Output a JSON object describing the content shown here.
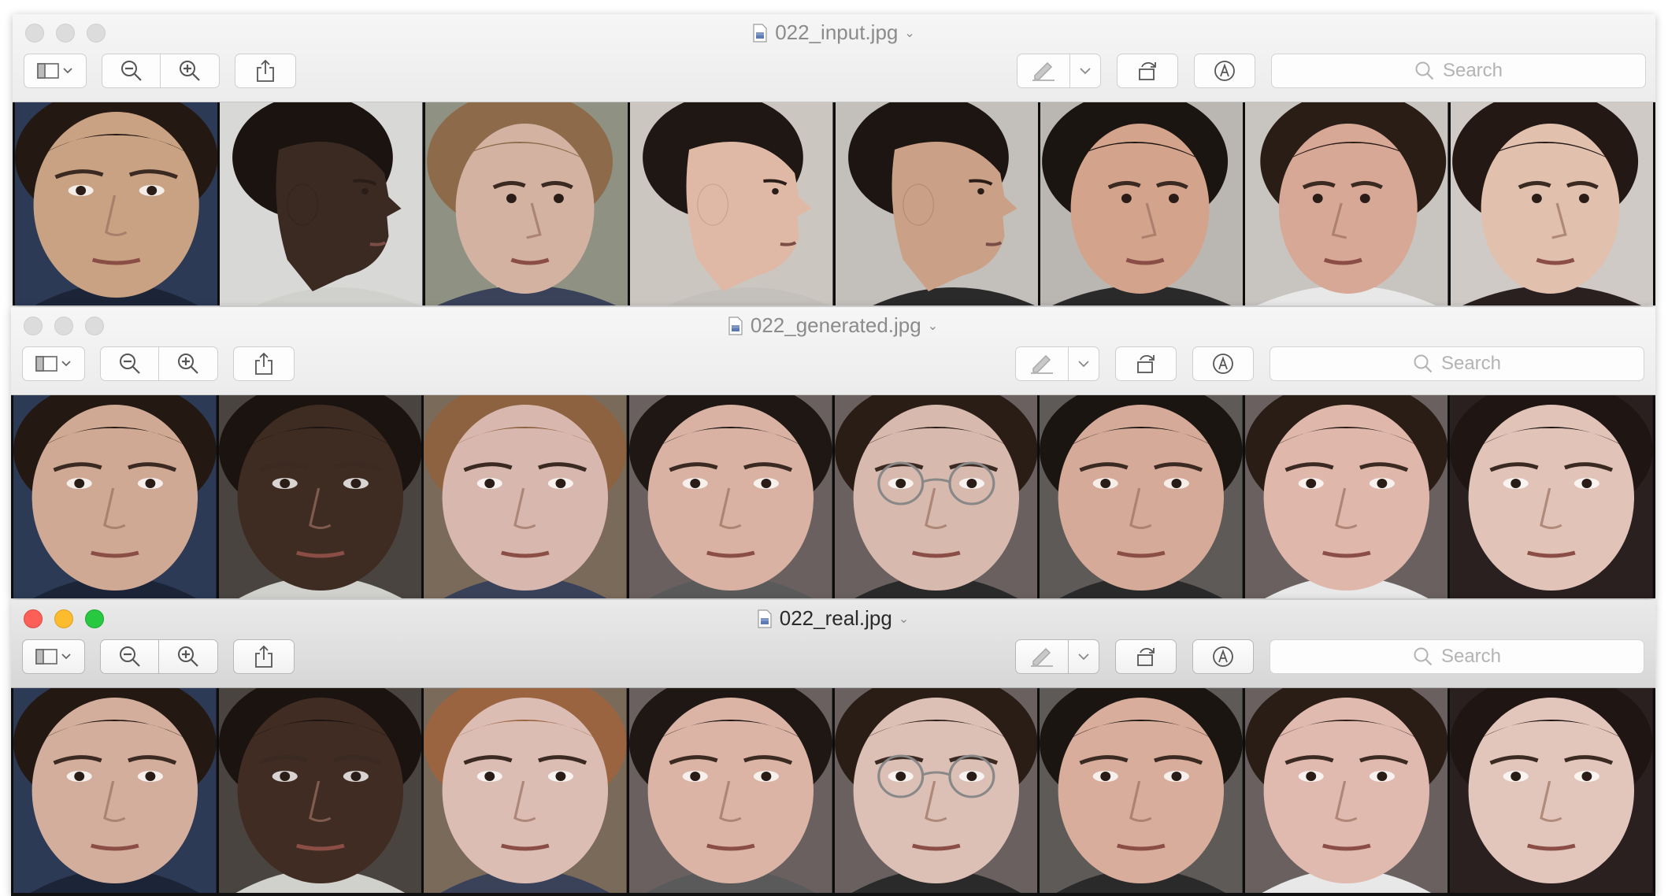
{
  "windows": [
    {
      "id": "input",
      "title": "022_input.jpg",
      "active": false,
      "search_placeholder": "Search",
      "faces": [
        {
          "label": "asian-woman-frontal",
          "pose": "front",
          "skin": "#c9a183",
          "hair": "#241813",
          "bg": "#2c3a55",
          "shirt": "#1c2438"
        },
        {
          "label": "dark-skinned-man-profile",
          "pose": "profile-right",
          "skin": "#3b2a22",
          "hair": "#1a1310",
          "bg": "#d8d8d6",
          "shirt": "#d0d0cc"
        },
        {
          "label": "curly-haired-woman-looking-right",
          "pose": "three-quarter-right",
          "skin": "#d4b2a2",
          "hair": "#8d6b4a",
          "bg": "#8f9282",
          "shirt": "#3a425a"
        },
        {
          "label": "man-profile-right",
          "pose": "profile-right",
          "skin": "#e0b9a6",
          "hair": "#1e1713",
          "bg": "#ccc6c0",
          "shirt": "#c4c0bc"
        },
        {
          "label": "woman-glasses-profile",
          "pose": "profile-right",
          "skin": "#caa086",
          "hair": "#1d1512",
          "bg": "#c3bfbb",
          "shirt": "#2a2a2a"
        },
        {
          "label": "smiling-man-three-quarter",
          "pose": "three-quarter-right",
          "skin": "#d4a38c",
          "hair": "#1b1512",
          "bg": "#bab6b2",
          "shirt": "#2a2a2a"
        },
        {
          "label": "young-man-three-quarter",
          "pose": "three-quarter-left",
          "skin": "#d8a896",
          "hair": "#2a1d16",
          "bg": "#c8c4c0",
          "shirt": "#e8e8e8"
        },
        {
          "label": "dark-haired-woman-three-quarter",
          "pose": "three-quarter-right",
          "skin": "#e2c0ae",
          "hair": "#241815",
          "bg": "#cfcac6",
          "shirt": "#2a2020"
        }
      ]
    },
    {
      "id": "generated",
      "title": "022_generated.jpg",
      "active": false,
      "search_placeholder": "Search",
      "faces": [
        {
          "label": "asian-woman-frontal",
          "pose": "front",
          "skin": "#d0a995",
          "hair": "#241813",
          "bg": "#2c3a55",
          "shirt": "#1c2438"
        },
        {
          "label": "dark-skinned-man-frontal",
          "pose": "front",
          "skin": "#3e2b22",
          "hair": "#1a1310",
          "bg": "#4a4440",
          "shirt": "#d0d0cc"
        },
        {
          "label": "curly-haired-woman-frontal",
          "pose": "front",
          "skin": "#d8b8ae",
          "hair": "#8d6240",
          "bg": "#7a6a5a",
          "shirt": "#3a425a"
        },
        {
          "label": "man-frontal",
          "pose": "front",
          "skin": "#d9b2a3",
          "hair": "#1e1713",
          "bg": "#6a6060",
          "shirt": "#5a5a5a"
        },
        {
          "label": "woman-glasses-frontal",
          "pose": "front",
          "skin": "#d7b9ad",
          "hair": "#2a1d16",
          "bg": "#6a6060",
          "shirt": "#2a2a2a",
          "glasses": true
        },
        {
          "label": "man-short-hair-frontal",
          "pose": "front",
          "skin": "#d6aa98",
          "hair": "#1b1512",
          "bg": "#5e5a58",
          "shirt": "#2a2a2a"
        },
        {
          "label": "young-man-frontal",
          "pose": "front",
          "skin": "#dfb7ab",
          "hair": "#2a1d16",
          "bg": "#6a6060",
          "shirt": "#e8e8e8"
        },
        {
          "label": "dark-haired-woman-frontal",
          "pose": "front",
          "skin": "#e1c3b8",
          "hair": "#1f1614",
          "bg": "#2a2020",
          "shirt": "#2a2020"
        }
      ]
    },
    {
      "id": "real",
      "title": "022_real.jpg",
      "active": true,
      "search_placeholder": "Search",
      "faces": [
        {
          "label": "asian-woman-frontal",
          "pose": "front",
          "skin": "#d3ae9c",
          "hair": "#241813",
          "bg": "#2c3a55",
          "shirt": "#1c2438"
        },
        {
          "label": "dark-skinned-man-frontal",
          "pose": "front",
          "skin": "#402c22",
          "hair": "#1a1310",
          "bg": "#4a4440",
          "shirt": "#d0d0cc"
        },
        {
          "label": "curly-haired-woman-frontal",
          "pose": "front",
          "skin": "#dbbdb4",
          "hair": "#9a6440",
          "bg": "#7a6a5a",
          "shirt": "#3a425a"
        },
        {
          "label": "man-frontal",
          "pose": "front",
          "skin": "#dbb4a6",
          "hair": "#1e1713",
          "bg": "#6a6060",
          "shirt": "#5a5a5a"
        },
        {
          "label": "woman-glasses-frontal",
          "pose": "front",
          "skin": "#dcc0b6",
          "hair": "#2a1d16",
          "bg": "#6a6060",
          "shirt": "#2a2a2a",
          "glasses": true
        },
        {
          "label": "man-short-hair-frontal",
          "pose": "front",
          "skin": "#d8ad9c",
          "hair": "#1b1512",
          "bg": "#5e5a58",
          "shirt": "#2a2a2a"
        },
        {
          "label": "young-man-frontal",
          "pose": "front",
          "skin": "#e0baae",
          "hair": "#2a1d16",
          "bg": "#6a6060",
          "shirt": "#e8e8e8"
        },
        {
          "label": "dark-haired-woman-frontal",
          "pose": "front",
          "skin": "#e3c6bb",
          "hair": "#1f1614",
          "bg": "#2a2020",
          "shirt": "#2a2020"
        }
      ]
    }
  ]
}
